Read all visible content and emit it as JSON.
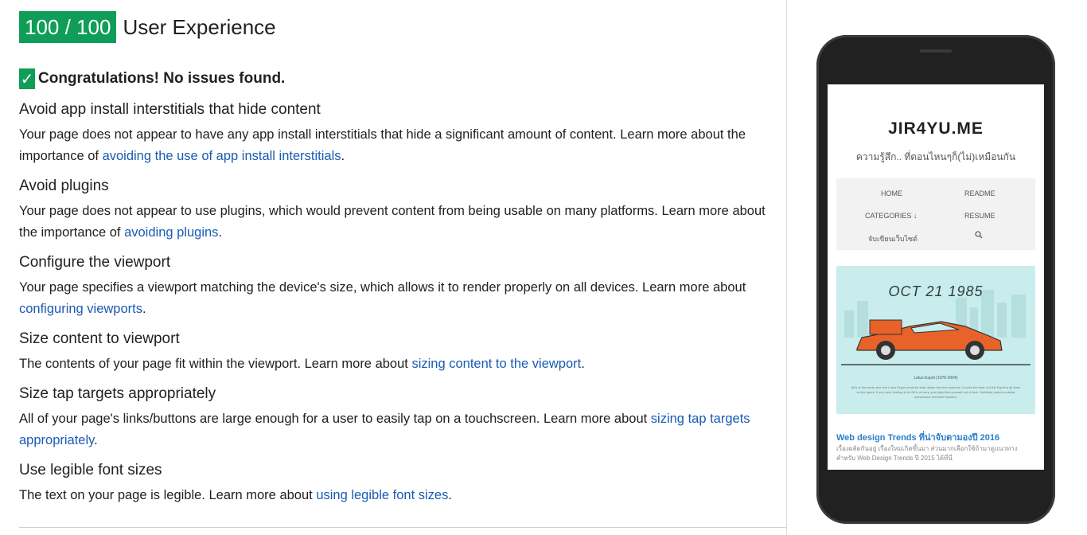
{
  "header": {
    "score": "100 / 100",
    "title": "User Experience"
  },
  "congrats": "Congratulations! No issues found.",
  "rules": [
    {
      "title": "Avoid app install interstitials that hide content",
      "text": "Your page does not appear to have any app install interstitials that hide a significant amount of content. Learn more about the importance of ",
      "link": "avoiding the use of app install interstitials",
      "after": "."
    },
    {
      "title": "Avoid plugins",
      "text": "Your page does not appear to use plugins, which would prevent content from being usable on many platforms. Learn more about the importance of ",
      "link": "avoiding plugins",
      "after": "."
    },
    {
      "title": "Configure the viewport",
      "text": "Your page specifies a viewport matching the device's size, which allows it to render properly on all devices. Learn more about ",
      "link": "configuring viewports",
      "after": "."
    },
    {
      "title": "Size content to viewport",
      "text": "The contents of your page fit within the viewport. Learn more about ",
      "link": "sizing content to the viewport",
      "after": "."
    },
    {
      "title": "Size tap targets appropriately",
      "text": "All of your page's links/buttons are large enough for a user to easily tap on a touchscreen. Learn more about ",
      "link": "sizing tap targets appropriately",
      "after": "."
    },
    {
      "title": "Use legible font sizes",
      "text": "The text on your page is legible. Learn more about ",
      "link": "using legible font sizes",
      "after": "."
    }
  ],
  "preview": {
    "site_title": "JIR4YU.ME",
    "tagline": "ความรู้สึก.. ที่ตอนไหนๆก็(ไม่)เหมือนกัน",
    "menu": {
      "home": "HOME",
      "readme": "README",
      "categories": "CATEGORIES ↓",
      "resume": "RESUME",
      "thai": "จับเขียนเว็บไซต์",
      "search_icon": "search-icon"
    },
    "hero_date": "OCT 21 1985",
    "hero_caption": "Lotus Esprit (1976-2004)",
    "hero_text": "80's of the iconic and one Lotus Esprit would be both driven the time machine. It looks the best, but the Esprit is all done on the opera. If you were looking to hit 88 in a hurry, you might find yourself out of luck. Definitely makes a stellar somewhere that time traveled.",
    "post_title": "Web design Trends ที่น่าจับตามองปี 2016",
    "post_body": "เรื่องผลัดกันอยู่ เรื่องใหม่เกิดขึ้นมา ส่วนมากเลือกใช้ถ้ามาดูแนวทางสำหรับ Web Design Trends ปี 2015 ได้ที่นี่",
    "colors": {
      "hero_bg": "#c9ecec",
      "car": "#e8622a",
      "link": "#2a7fc9"
    }
  },
  "colors": {
    "score_bg": "#0f9d58",
    "link": "#1a5bb3"
  }
}
